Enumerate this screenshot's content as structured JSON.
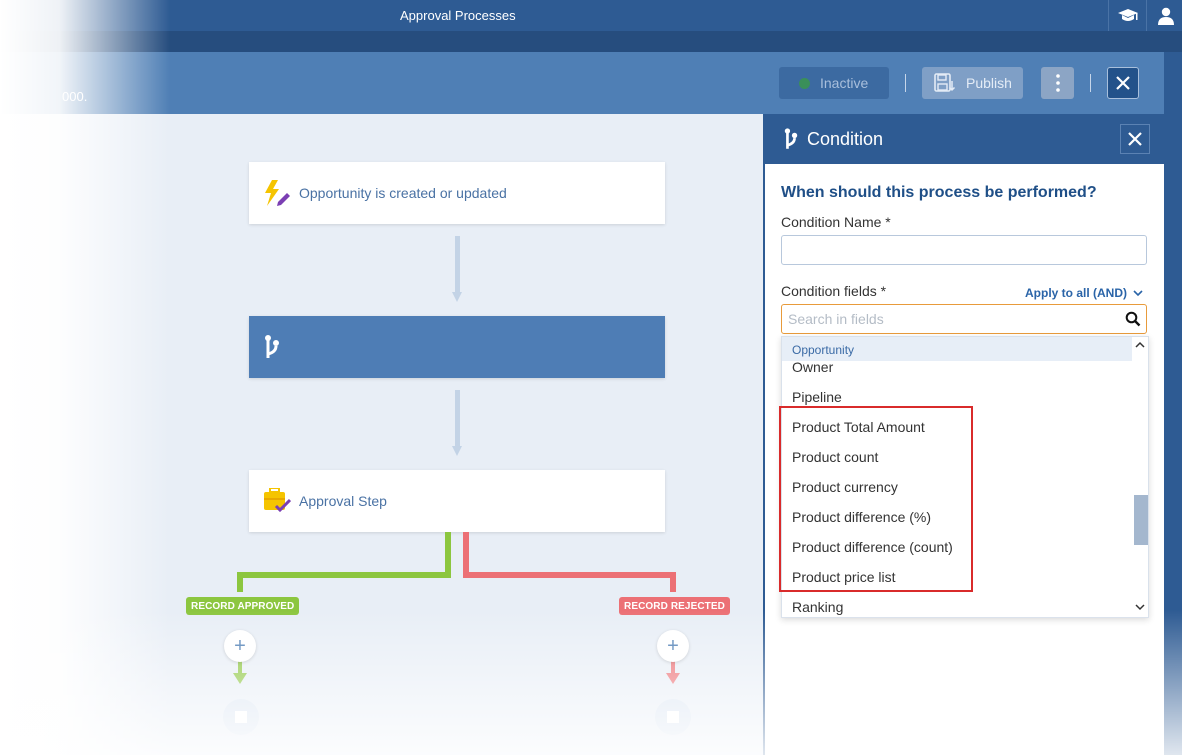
{
  "topbar": {
    "title": "Approval Processes",
    "icons": [
      "graduation-cap-icon",
      "user-icon"
    ]
  },
  "header": {
    "partial_text": "000.",
    "inactive_label": "Inactive",
    "publish_label": "Publish",
    "status_color": "#3a8f5a"
  },
  "canvas": {
    "trigger_label": "Opportunity is created or updated",
    "approval_label": "Approval Step",
    "approved_badge": "RECORD APPROVED",
    "rejected_badge": "RECORD REJECTED",
    "approved_color": "#8cc63f",
    "rejected_color": "#ec7075"
  },
  "panel": {
    "title": "Condition",
    "question": "When should this process be performed?",
    "condition_name_label": "Condition Name *",
    "condition_name_value": "",
    "condition_fields_label": "Condition fields *",
    "apply_label": "Apply to all (AND)",
    "search_placeholder": "Search in fields",
    "group_header": "Opportunity",
    "options": [
      "Owner",
      "Pipeline",
      "Product Total Amount",
      "Product count",
      "Product currency",
      "Product difference (%)",
      "Product difference (count)",
      "Product price list",
      "Ranking"
    ],
    "accent_color": "#2e5b93"
  }
}
